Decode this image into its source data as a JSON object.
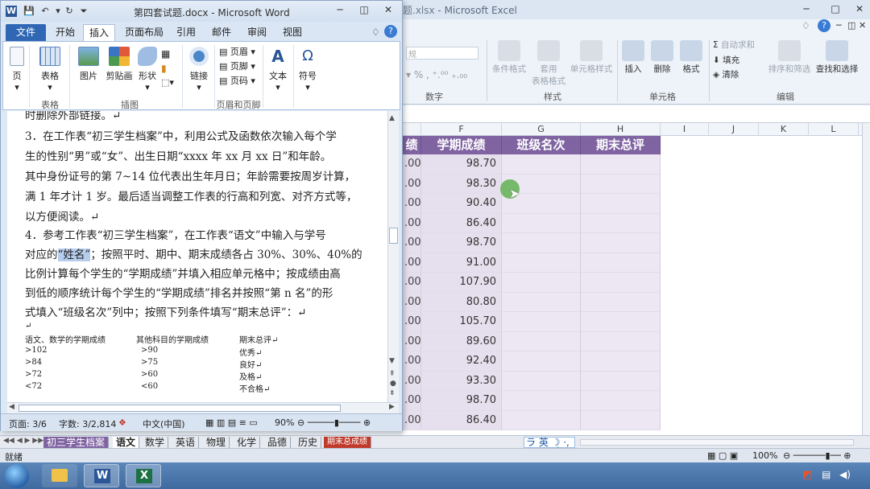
{
  "excel": {
    "title_file": "题.xlsx",
    "title_sep": " - ",
    "title_app": "Microsoft Excel",
    "ribbon": {
      "number_group_label": "数字",
      "style_group_label": "样式",
      "cells_group_label": "单元格",
      "edit_group_label": "编辑",
      "conditional_format": "条件格式",
      "table_format": "套用\n表格格式",
      "cell_styles": "单元格样式",
      "insert": "插入",
      "delete": "删除",
      "format": "格式",
      "autosum": "自动求和",
      "fill": "填充",
      "clear": "清除",
      "sort_filter": "排序和筛选",
      "find_select": "查找和选择"
    },
    "columns": [
      "F",
      "G",
      "H",
      "I",
      "J",
      "K",
      "L"
    ],
    "header_row": {
      "e_partial": "绩",
      "f": "学期成绩",
      "g": "班级名次",
      "h": "期末总评"
    },
    "rows": [
      {
        "e": ".00",
        "f": "98.70"
      },
      {
        "e": ".00",
        "f": "98.30"
      },
      {
        "e": ".00",
        "f": "90.40"
      },
      {
        "e": ".00",
        "f": "86.40"
      },
      {
        "e": ".00",
        "f": "98.70"
      },
      {
        "e": ".00",
        "f": "91.00"
      },
      {
        "e": ".00",
        "f": "107.90"
      },
      {
        "e": ".00",
        "f": "80.80"
      },
      {
        "e": ".00",
        "f": "105.70"
      },
      {
        "e": ".00",
        "f": "89.60"
      },
      {
        "e": ".00",
        "f": "92.40"
      },
      {
        "e": ".00",
        "f": "93.30"
      },
      {
        "e": ".00",
        "f": "98.70"
      },
      {
        "e": ".00",
        "f": "86.40"
      }
    ],
    "sheet_tabs": [
      "初三学生档案",
      "语文",
      "数学",
      "英语",
      "物理",
      "化学",
      "品德",
      "历史",
      "期末总成绩"
    ],
    "status_ready": "就绪",
    "zoom": "100%",
    "ime": "英"
  },
  "word": {
    "title": "第四套试题.docx - Microsoft Word",
    "tabs": [
      "文件",
      "开始",
      "插入",
      "页面布局",
      "引用",
      "邮件",
      "审阅",
      "视图"
    ],
    "ribbon": {
      "page": "页",
      "table": "表格",
      "picture": "图片",
      "clipart": "剪贴画",
      "shapes": "形状",
      "link": "链接",
      "header": "页眉",
      "footer": "页脚",
      "pagenum": "页码",
      "text": "文本",
      "symbol": "符号",
      "group_table": "表格",
      "group_illus": "插图",
      "group_hf": "页眉和页脚"
    },
    "doc_lines": [
      "时删除外部链接。↵",
      "3．在工作表“初三学生档案”中，利用公式及函数依次输入每个学",
      "生的性别“男”或“女”、出生日期“xxxx 年 xx 月 xx 日”和年龄。",
      "其中身份证号的第 7~14 位代表出生年月日；年龄需要按周岁计算，",
      "满 1 年才计 1 岁。最后适当调整工作表的行高和列宽、对齐方式等，",
      "以方便阅读。↵",
      "4．参考工作表“初三学生档案”，在工作表“语文”中输入与学号",
      "对应的",
      "“姓名”",
      "；按照平时、期中、期末成绩各占 30%、30%、40%的",
      "比例计算每个学生的“学期成绩”并填入相应单元格中；按成绩由高",
      "到低的顺序统计每个学生的“学期成绩”排名并按照“第 n 名”的形",
      "式填入“班级名次”列中；按照下列条件填写“期末总评”：↵"
    ],
    "criteria": {
      "headers": [
        "语文、数学的学期成绩",
        "其他科目的学期成绩",
        "期末总评↵"
      ],
      "rows": [
        [
          ">102",
          ">90",
          "优秀↵"
        ],
        [
          ">84",
          ">75",
          "良好↵"
        ],
        [
          ">72",
          ">60",
          "及格↵"
        ],
        [
          "<72",
          "<60",
          "不合格↵"
        ]
      ]
    },
    "status": {
      "page": "页面: 3/6",
      "words": "字数: 3/2,814",
      "lang": "中文(中国)",
      "zoom": "90%"
    }
  },
  "colors": {
    "excel_header_purple": "#8064a2",
    "excel_cell_lavender": "#e6e0ee",
    "word_file_tab": "#2f67b4",
    "taskbar": "#4a76ac"
  }
}
